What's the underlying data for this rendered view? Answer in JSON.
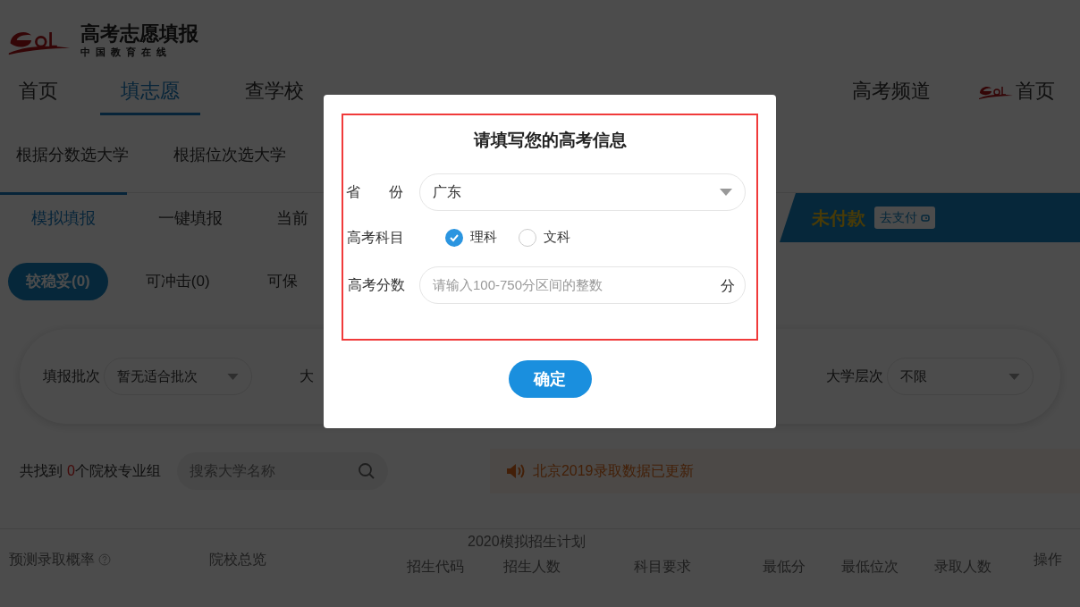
{
  "header": {
    "title": "高考志愿填报",
    "subtitle": "中国教育在线"
  },
  "nav": [
    {
      "label": "首页",
      "selected": false
    },
    {
      "label": "填志愿",
      "selected": true
    },
    {
      "label": "查学校",
      "selected": false
    },
    {
      "label": "高考频道",
      "selected": false
    }
  ],
  "nav_home_link": "首页",
  "subnav": [
    "根据分数选大学",
    "根据位次选大学"
  ],
  "tabs": [
    {
      "label": "模拟填报",
      "selected": true
    },
    {
      "label": "一键填报",
      "selected": false
    },
    {
      "label": "当前",
      "selected": false
    }
  ],
  "payment": {
    "status": "未付款",
    "button": "去支付"
  },
  "categories": [
    {
      "label": "较稳妥(0)",
      "selected": true
    },
    {
      "label": "可冲击(0)",
      "selected": false
    },
    {
      "label": "可保",
      "selected": false
    }
  ],
  "filters": [
    {
      "label": "填报批次",
      "value": "暂无适合批次"
    },
    {
      "label": "大"
    },
    {
      "label": "大学层次",
      "value": "不限"
    }
  ],
  "results": {
    "prefix": "共找到",
    "count": "0",
    "suffix": "个院校专业组"
  },
  "search": {
    "placeholder": "搜索大学名称"
  },
  "notice": "北京2019录取数据已更新",
  "table": {
    "columns_top": [
      "预测录取概率",
      "院校总览",
      "2020模拟招生计划",
      "操作"
    ],
    "columns_sub": [
      "招生代码",
      "招生人数",
      "科目要求",
      "最低分",
      "最低位次",
      "录取人数"
    ]
  },
  "modal": {
    "title": "请填写您的高考信息",
    "province": {
      "label": "省　　份",
      "value": "广东"
    },
    "subject": {
      "label": "高考科目",
      "options": [
        {
          "label": "理科",
          "selected": true
        },
        {
          "label": "文科",
          "selected": false
        }
      ]
    },
    "score": {
      "label": "高考分数",
      "placeholder": "请输入100-750分区间的整数",
      "unit": "分"
    },
    "confirm": "确定"
  }
}
